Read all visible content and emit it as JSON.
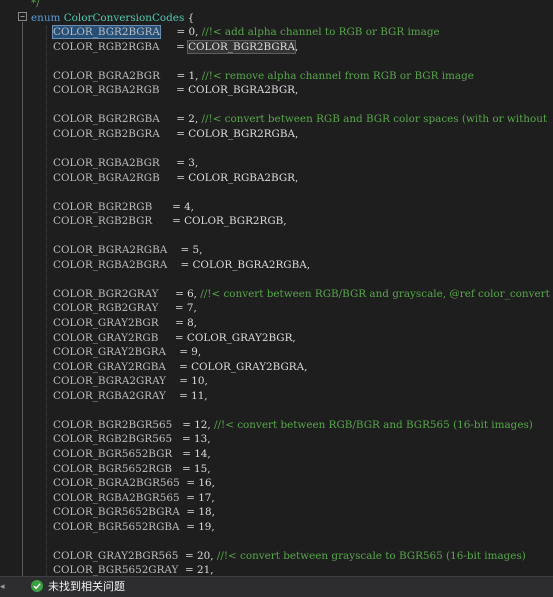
{
  "colors": {
    "background": "#1e1e1e",
    "comment": "#57a64a",
    "keyword": "#569cd6",
    "type_name": "#4ec9b0",
    "selection": "#264f78",
    "status_ok": "#3ea045"
  },
  "code": {
    "top_comment": "*/",
    "enum_keyword": "enum",
    "enum_name": "ColorConversionCodes",
    "enum_brace": " {",
    "lines": [
      {
        "name": "COLOR_BGR2BGRA",
        "pad": "     ",
        "value": "= 0,",
        "comment": " //!< add alpha channel to RGB or BGR image"
      },
      {
        "name": "COLOR_RGB2RGBA",
        "pad": "     ",
        "value": "= ",
        "ref": "COLOR_BGR2BGRA",
        "tail": ","
      },
      {
        "blank": true
      },
      {
        "name": "COLOR_BGRA2BGR",
        "pad": "     ",
        "value": "= 1,",
        "comment": " //!< remove alpha channel from RGB or BGR image"
      },
      {
        "name": "COLOR_RGBA2RGB",
        "pad": "     ",
        "value": "= COLOR_BGRA2BGR,"
      },
      {
        "blank": true
      },
      {
        "name": "COLOR_BGR2RGBA",
        "pad": "     ",
        "value": "= 2,",
        "comment": " //!< convert between RGB and BGR color spaces (with or without"
      },
      {
        "name": "COLOR_RGB2BGRA",
        "pad": "     ",
        "value": "= COLOR_BGR2RGBA,"
      },
      {
        "blank": true
      },
      {
        "name": "COLOR_RGBA2BGR",
        "pad": "     ",
        "value": "= 3,"
      },
      {
        "name": "COLOR_BGRA2RGB",
        "pad": "     ",
        "value": "= COLOR_RGBA2BGR,"
      },
      {
        "blank": true
      },
      {
        "name": "COLOR_BGR2RGB",
        "pad": "      ",
        "value": "= 4,"
      },
      {
        "name": "COLOR_RGB2BGR",
        "pad": "      ",
        "value": "= COLOR_BGR2RGB,"
      },
      {
        "blank": true
      },
      {
        "name": "COLOR_BGRA2RGBA",
        "pad": "    ",
        "value": "= 5,"
      },
      {
        "name": "COLOR_RGBA2BGRA",
        "pad": "    ",
        "value": "= COLOR_BGRA2RGBA,"
      },
      {
        "blank": true
      },
      {
        "name": "COLOR_BGR2GRAY",
        "pad": "     ",
        "value": "= 6,",
        "comment": " //!< convert between RGB/BGR and grayscale, @ref color_convert"
      },
      {
        "name": "COLOR_RGB2GRAY",
        "pad": "     ",
        "value": "= 7,"
      },
      {
        "name": "COLOR_GRAY2BGR",
        "pad": "     ",
        "value": "= 8,"
      },
      {
        "name": "COLOR_GRAY2RGB",
        "pad": "     ",
        "value": "= COLOR_GRAY2BGR,"
      },
      {
        "name": "COLOR_GRAY2BGRA",
        "pad": "    ",
        "value": "= 9,"
      },
      {
        "name": "COLOR_GRAY2RGBA",
        "pad": "    ",
        "value": "= COLOR_GRAY2BGRA,"
      },
      {
        "name": "COLOR_BGRA2GRAY",
        "pad": "    ",
        "value": "= 10,"
      },
      {
        "name": "COLOR_RGBA2GRAY",
        "pad": "    ",
        "value": "= 11,"
      },
      {
        "blank": true
      },
      {
        "name": "COLOR_BGR2BGR565",
        "pad": "   ",
        "value": "= 12,",
        "comment": " //!< convert between RGB/BGR and BGR565 (16-bit images)"
      },
      {
        "name": "COLOR_RGB2BGR565",
        "pad": "   ",
        "value": "= 13,"
      },
      {
        "name": "COLOR_BGR5652BGR",
        "pad": "   ",
        "value": "= 14,"
      },
      {
        "name": "COLOR_BGR5652RGB",
        "pad": "   ",
        "value": "= 15,"
      },
      {
        "name": "COLOR_BGRA2BGR565",
        "pad": "  ",
        "value": "= 16,"
      },
      {
        "name": "COLOR_RGBA2BGR565",
        "pad": "  ",
        "value": "= 17,"
      },
      {
        "name": "COLOR_BGR5652BGRA",
        "pad": "  ",
        "value": "= 18,"
      },
      {
        "name": "COLOR_BGR5652RGBA",
        "pad": "  ",
        "value": "= 19,"
      },
      {
        "blank": true
      },
      {
        "name": "COLOR_GRAY2BGR565",
        "pad": "  ",
        "value": "= 20,",
        "comment": " //!< convert between grayscale to BGR565 (16-bit images)"
      },
      {
        "name": "COLOR_BGR5652GRAY",
        "pad": "  ",
        "value": "= 21,"
      }
    ]
  },
  "status": {
    "icon": "check-circle-icon",
    "message": "未找到相关问题"
  }
}
